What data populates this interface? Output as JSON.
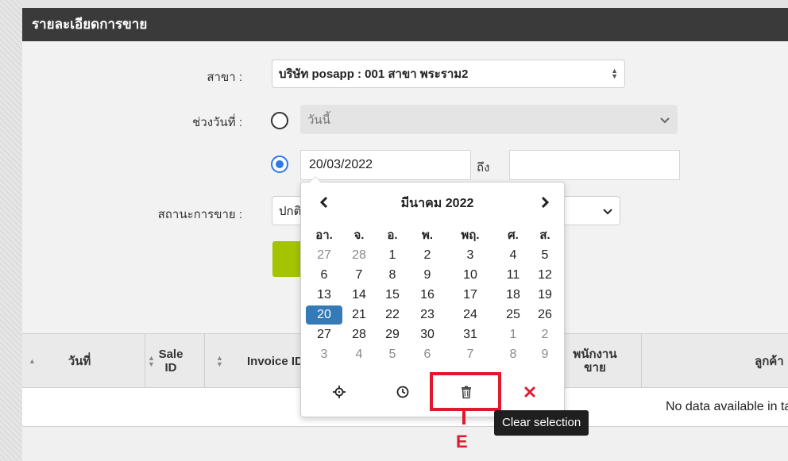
{
  "header": {
    "title": "รายละเอียดการขาย"
  },
  "form": {
    "branch_label": "สาขา :",
    "branch_value": "บริษัท posapp : 001 สาขา พระราม2",
    "daterange_label": "ช่วงวันที่ :",
    "preset_value": "วันนี้",
    "date_from": "20/03/2022",
    "to_label": "ถึง",
    "date_to": "",
    "status_label": "สถานะการขาย :",
    "status_value": "ปกติ"
  },
  "table": {
    "columns": [
      "วันที่",
      "Sale ID",
      "Invoice ID",
      "พนักงานขาย",
      "ลูกค้า"
    ],
    "col_sale_1": "Sale",
    "col_sale_2": "ID",
    "col_invoice": "Invoice ID",
    "col_employee_1": "พนักงาน",
    "col_employee_2": "ขาย",
    "empty_message": "No data available in table"
  },
  "datepicker": {
    "month_title": "มีนาคม 2022",
    "weekdays": [
      "อา.",
      "จ.",
      "อ.",
      "พ.",
      "พฤ.",
      "ศ.",
      "ส."
    ],
    "weeks": [
      [
        {
          "d": "27",
          "m": true
        },
        {
          "d": "28",
          "m": true
        },
        {
          "d": "1"
        },
        {
          "d": "2"
        },
        {
          "d": "3"
        },
        {
          "d": "4"
        },
        {
          "d": "5"
        }
      ],
      [
        {
          "d": "6"
        },
        {
          "d": "7"
        },
        {
          "d": "8"
        },
        {
          "d": "9"
        },
        {
          "d": "10"
        },
        {
          "d": "11"
        },
        {
          "d": "12"
        }
      ],
      [
        {
          "d": "13"
        },
        {
          "d": "14"
        },
        {
          "d": "15"
        },
        {
          "d": "16"
        },
        {
          "d": "17"
        },
        {
          "d": "18"
        },
        {
          "d": "19"
        }
      ],
      [
        {
          "d": "20",
          "a": true
        },
        {
          "d": "21"
        },
        {
          "d": "22"
        },
        {
          "d": "23"
        },
        {
          "d": "24"
        },
        {
          "d": "25"
        },
        {
          "d": "26"
        }
      ],
      [
        {
          "d": "27"
        },
        {
          "d": "28"
        },
        {
          "d": "29"
        },
        {
          "d": "30"
        },
        {
          "d": "31"
        },
        {
          "d": "1",
          "m": true
        },
        {
          "d": "2",
          "m": true
        }
      ],
      [
        {
          "d": "3",
          "m": true
        },
        {
          "d": "4",
          "m": true
        },
        {
          "d": "5",
          "m": true
        },
        {
          "d": "6",
          "m": true
        },
        {
          "d": "7",
          "m": true
        },
        {
          "d": "8",
          "m": true
        },
        {
          "d": "9",
          "m": true
        }
      ]
    ],
    "tools": [
      "crosshairs-icon",
      "clock-icon",
      "trash-icon",
      "close-icon"
    ]
  },
  "tooltip": {
    "text": "Clear selection"
  },
  "annotation": {
    "letter": "E",
    "color": "#e0192c"
  },
  "colors": {
    "header_bg": "#3a3a3a",
    "accent_blue": "#337ab7",
    "radio_blue": "#2f7ae5",
    "button_green": "#a4c300"
  }
}
